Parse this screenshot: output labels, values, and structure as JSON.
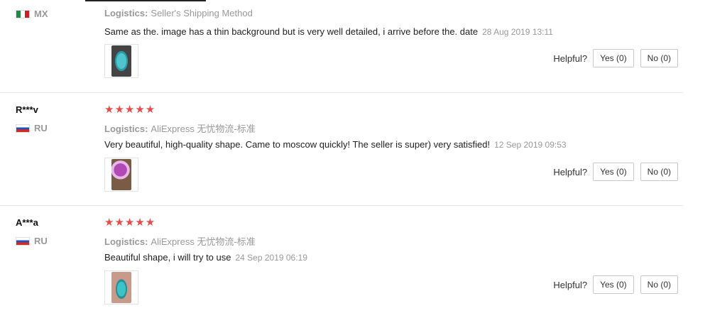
{
  "reviews": [
    {
      "username": "",
      "country": "MX",
      "flag_colors": [
        "#1f8a47",
        "#ffffff",
        "#c8202a"
      ],
      "stars": "",
      "logistics_label": "Logistics:",
      "logistics_value": "Seller's Shipping Method",
      "feedback": "Same as the. image has a thin background but is very well detailed, i arrive before the. date",
      "date": "28 Aug 2019 13:11",
      "helpful_label": "Helpful?",
      "yes_label": "Yes (0)",
      "no_label": "No (0)"
    },
    {
      "username": "R***v",
      "country": "RU",
      "flag_colors": [
        "#ffffff",
        "#2a4eb8",
        "#d52b1e"
      ],
      "stars": "★★★★★",
      "logistics_label": "Logistics:",
      "logistics_value": "AliExpress 无忧物流-标准",
      "feedback": "Very beautiful, high-quality shape. Came to moscow quickly! The seller is super) very satisfied!",
      "date": "12 Sep 2019 09:53",
      "helpful_label": "Helpful?",
      "yes_label": "Yes (0)",
      "no_label": "No (0)"
    },
    {
      "username": "A***a",
      "country": "RU",
      "flag_colors": [
        "#ffffff",
        "#2a4eb8",
        "#d52b1e"
      ],
      "stars": "★★★★★",
      "logistics_label": "Logistics:",
      "logistics_value": "AliExpress 无忧物流-标准",
      "feedback": "Beautiful shape, i will try to use",
      "date": "24 Sep 2019 06:19",
      "helpful_label": "Helpful?",
      "yes_label": "Yes (0)",
      "no_label": "No (0)"
    }
  ],
  "colors": {
    "star": "#e54d4d",
    "muted_text": "#999999",
    "divider": "#e8e8e8"
  }
}
